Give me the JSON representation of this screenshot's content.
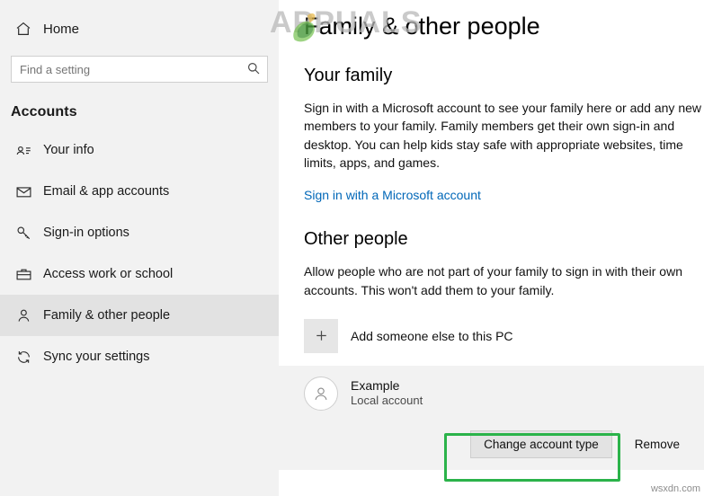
{
  "sidebar": {
    "home": {
      "label": "Home",
      "icon": "home-icon"
    },
    "search": {
      "placeholder": "Find a setting",
      "value": "",
      "icon": "search-icon"
    },
    "section": "Accounts",
    "items": [
      {
        "label": "Your info",
        "icon": "user-card-icon",
        "selected": false
      },
      {
        "label": "Email & app accounts",
        "icon": "envelope-icon",
        "selected": false
      },
      {
        "label": "Sign-in options",
        "icon": "key-icon",
        "selected": false
      },
      {
        "label": "Access work or school",
        "icon": "briefcase-icon",
        "selected": false
      },
      {
        "label": "Family & other people",
        "icon": "people-icon",
        "selected": true
      },
      {
        "label": "Sync your settings",
        "icon": "sync-icon",
        "selected": false
      }
    ]
  },
  "main": {
    "title": "Family & other people",
    "family": {
      "heading": "Your family",
      "description": "Sign in with a Microsoft account to see your family here or add any new members to your family. Family members get their own sign-in and desktop. You can help kids stay safe with appropriate websites, time limits, apps, and games.",
      "link": "Sign in with a Microsoft account"
    },
    "other_people": {
      "heading": "Other people",
      "description": "Allow people who are not part of your family to sign in with their own accounts. This won't add them to your family.",
      "add_label": "Add someone else to this PC",
      "add_icon": "plus-icon",
      "account": {
        "name": "Example",
        "type": "Local account",
        "avatar_icon": "avatar-icon"
      },
      "buttons": {
        "change_type": "Change account type",
        "remove": "Remove"
      }
    }
  },
  "overlay": {
    "watermark": "APPUALS",
    "corner_tag": "wsxdn.com",
    "highlight_color": "#2bb34a"
  }
}
